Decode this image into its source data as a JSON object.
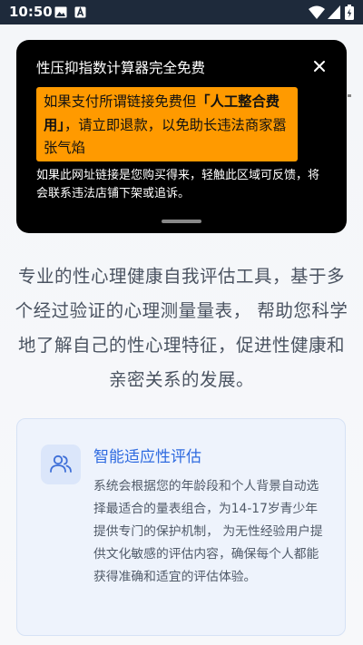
{
  "status_bar": {
    "time": "10:50",
    "left_icons": [
      "image-icon",
      "a-box-icon"
    ],
    "right_icons": [
      "wifi-icon",
      "signal-icon",
      "battery-icon"
    ]
  },
  "main": {
    "description": "专业的性心理健康自我评估工具，基于多个经过验证的心理测量量表， 帮助您科学地了解自己的性心理特征，促进性健康和亲密关系的发展。",
    "feature_card": {
      "icon": "users-icon",
      "title": "智能适应性评估",
      "text": "系统会根据您的年龄段和个人背景自动选择最适合的量表组合，为14-17岁青少年提供专门的保护机制， 为无性经验用户提供文化敏感的评估内容，确保每个人都能获得准确和适宜的评估体验。"
    }
  },
  "overlay": {
    "title": "性压抑指数计算器完全免费",
    "close_icon": "close-icon",
    "warning_pre": "如果支付所谓链接免费但",
    "warning_highlight": "「人工整合费用」",
    "warning_post": "，请立即退款，以免助长违法商家嚣张气焰",
    "note": "如果此网址链接是您购买得来，轻触此区域可反馈，将会联系违法店铺下架或追诉。"
  },
  "colors": {
    "status_bar_bg": "#1e2a3b",
    "overlay_bg": "#000000",
    "warning_bg": "#ff9a00",
    "accent_blue": "#2f6be0",
    "card_bg": "#eef3fc"
  }
}
